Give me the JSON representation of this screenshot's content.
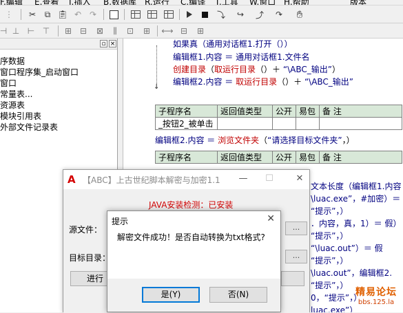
{
  "menubar": {
    "items": [
      "F.编辑",
      "E.查看",
      "I.插入",
      "B.数据库",
      "R.运行",
      "C.编译",
      "T.工具",
      "W.窗口",
      "H.帮助",
      "版本"
    ]
  },
  "toolbar1": {
    "icons": [
      "cut-icon",
      "copy-icon",
      "paste-icon",
      "undo-icon",
      "redo-icon",
      "find-icon",
      "layout-1-icon",
      "layout-2-icon",
      "layout-3-icon",
      "run-icon",
      "stop-icon",
      "step-into-icon",
      "step-over-icon",
      "step-out-icon",
      "hand-icon"
    ]
  },
  "toolbar2": {
    "icons": [
      "align-left-icon",
      "align-center-v-icon",
      "align-right-icon",
      "align-top-icon",
      "align-bottom-icon",
      "align-center-h-icon",
      "same-width-icon",
      "same-height-icon",
      "same-size-icon",
      "h-space-icon",
      "v-space-icon",
      "center-h-icon",
      "center-v-icon",
      "width-icon",
      "grid-icon"
    ]
  },
  "left_panel": {
    "items": [
      "序数据",
      "窗口程序集_启动窗口",
      "窗口",
      "常量表...",
      "资源表",
      "模块引用表",
      "外部文件记录表"
    ]
  },
  "code": {
    "lines": [
      {
        "parts": [
          {
            "t": "如果真",
            "c": "kw"
          },
          {
            "t": "（通用对话框1.",
            "c": "kw"
          },
          {
            "t": "打开",
            "c": "kw"
          },
          {
            "t": "（））",
            "c": "kw"
          }
        ]
      },
      {
        "parts": [
          {
            "t": "编辑框1.内容 ＝ 通用对话框1.文件名",
            "c": "kw"
          }
        ]
      },
      {
        "parts": [
          {
            "t": "创建目录",
            "c": "red"
          },
          {
            "t": "（",
            "c": "blk"
          },
          {
            "t": "取运行目录",
            "c": "red"
          },
          {
            "t": "（）＋ ",
            "c": "blk"
          },
          {
            "t": "“\\ABC_输出”",
            "c": "str"
          },
          {
            "t": "）",
            "c": "blk"
          }
        ]
      },
      {
        "parts": [
          {
            "t": "编辑框2.内容 ＝ ",
            "c": "kw"
          },
          {
            "t": "取运行目录",
            "c": "red"
          },
          {
            "t": "（）＋ ",
            "c": "blk"
          },
          {
            "t": "“\\ABC_输出”",
            "c": "str"
          }
        ]
      }
    ],
    "table1": {
      "headers": [
        "子程序名",
        "返回值类型",
        "公开",
        "易包",
        "备 注"
      ],
      "row": [
        "_按钮2_被单击",
        "",
        "",
        "",
        ""
      ]
    },
    "line_browse": [
      {
        "t": "编辑框2.内容 ＝ ",
        "c": "kw"
      },
      {
        "t": "浏览文件夹",
        "c": "red"
      },
      {
        "t": "（",
        "c": "blk"
      },
      {
        "t": "“请选择目标文件夹”",
        "c": "str"
      },
      {
        "t": "，）",
        "c": "blk"
      }
    ],
    "table2": {
      "headers": [
        "子程序名",
        "返回值类型",
        "公开",
        "易包",
        "备 注"
      ]
    },
    "partial_lines": [
      "文本长度（编辑框1.内容",
      "\\luac.exe”，#加密）＝",
      "“提示”，）",
      "．内容，真，1）＝ 假）",
      "“提示”，）",
      "“\\luac.out”）＝ 假",
      "“提示”，）",
      "\\luac.out”，编辑框2.",
      "“提示”，）",
      "0，“提示”，）",
      "luac.exe”）"
    ]
  },
  "main_dialog": {
    "logo": "A",
    "title": "【ABC】上古世纪脚本解密与加密1.1",
    "java_status": "JAVA安装检测：已安装",
    "source_label": "源文件：",
    "target_label": "目标目录：",
    "browse_label": "...",
    "run_label": "进行"
  },
  "message_box": {
    "title": "提示",
    "text": "解密文件成功！是否自动转换为txt格式?",
    "yes_label": "是(Y)",
    "no_label": "否(N)"
  },
  "watermark": {
    "line1": "精易论坛",
    "line2": "bbs.125.la"
  }
}
